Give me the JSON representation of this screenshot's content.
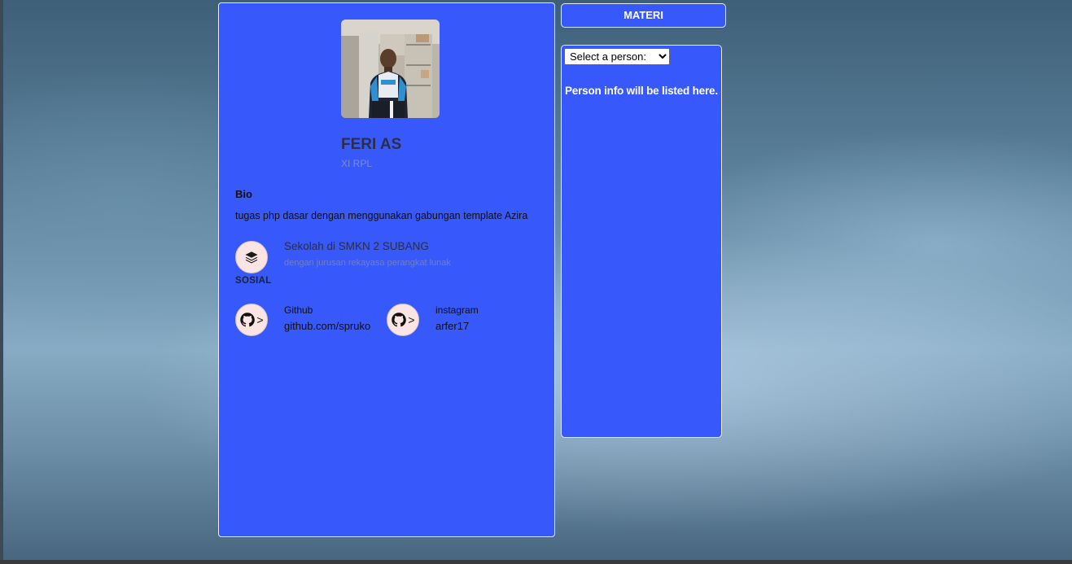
{
  "profile": {
    "name": "FERI AS",
    "class": "XI RPL",
    "bio_title": "Bio",
    "bio_text": "tugas php dasar dengan menggunakan gabungan template Azira"
  },
  "school": {
    "title": "Sekolah di SMKN 2 SUBANG",
    "subtitle": "dengan jurusan rekayasa perangkat lunak",
    "section_label": "SOSIAL",
    "icon": "layers-icon"
  },
  "links": [
    {
      "label": "Github",
      "value": "github.com/spruko",
      "icon": "github-icon",
      "icon_suffix": ">"
    },
    {
      "label": "instagram",
      "value": "arfer17",
      "icon": "github-icon",
      "icon_suffix": ">"
    }
  ],
  "sidebar": {
    "materi_label": "MATERI",
    "select_selected": "Select a person:",
    "person_info": "Person info will be listed here."
  },
  "colors": {
    "card_bg": "#3758fb",
    "icon_circle_bg": "#fae4e4"
  }
}
